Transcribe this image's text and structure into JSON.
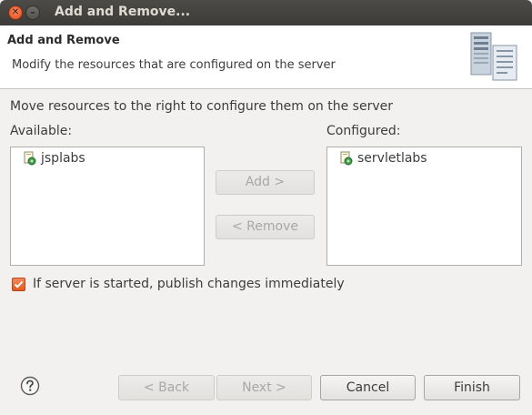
{
  "window": {
    "title": "Add and Remove..."
  },
  "banner": {
    "title": "Add and Remove",
    "description": "Modify the resources that are configured on the server",
    "icon": "server-wizard-icon"
  },
  "instructions": "Move resources to the right to configure them on the server",
  "available": {
    "label": "Available:",
    "items": [
      {
        "label": "jsplabs",
        "icon": "web-module-icon"
      }
    ]
  },
  "configured": {
    "label": "Configured:",
    "items": [
      {
        "label": "servletlabs",
        "icon": "web-module-icon"
      }
    ]
  },
  "buttons": {
    "add": "Add >",
    "remove": "< Remove",
    "back": "< Back",
    "next": "Next >",
    "cancel": "Cancel",
    "finish": "Finish"
  },
  "publish_option": {
    "label": "If server is started, publish changes immediately",
    "checked": true
  },
  "colors": {
    "checkbox_accent": "#e05a1f",
    "close_button": "#df4a16"
  }
}
